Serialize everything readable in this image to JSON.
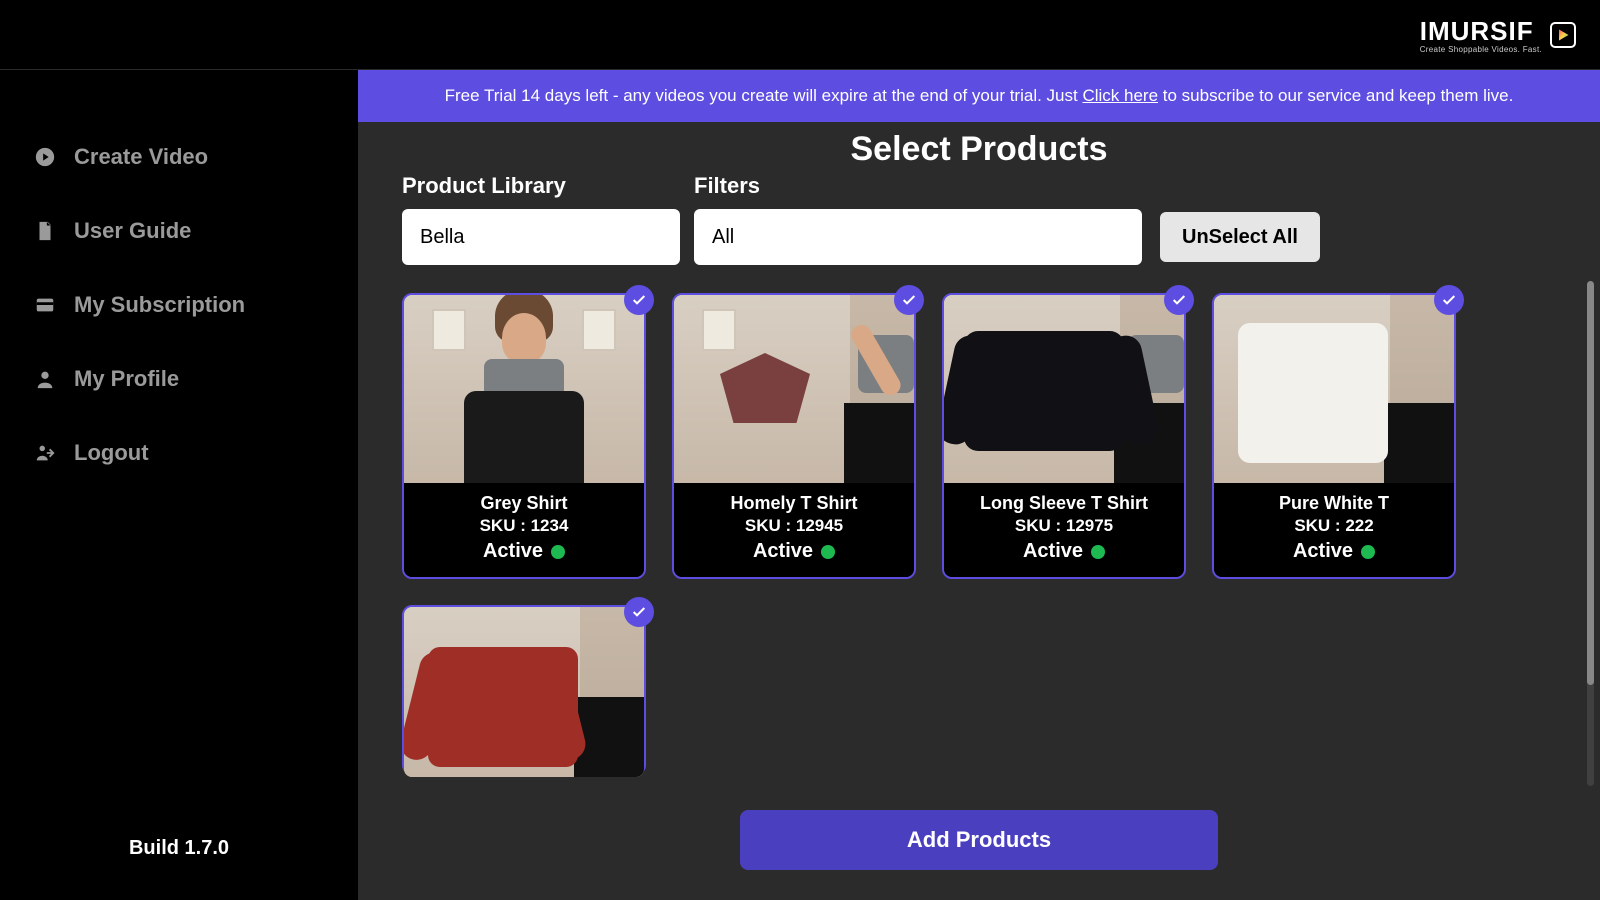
{
  "brand": {
    "name": "IMURSIF",
    "tagline": "Create Shoppable Videos. Fast."
  },
  "banner": {
    "pre": "Free Trial 14 days left - any videos you create will expire at the end of your trial. Just ",
    "link": "Click here",
    "post": " to subscribe to our service and keep them live."
  },
  "sidebar": {
    "items": [
      {
        "label": "Create Video",
        "icon": "play"
      },
      {
        "label": "User Guide",
        "icon": "doc"
      },
      {
        "label": "My Subscription",
        "icon": "card"
      },
      {
        "label": "My Profile",
        "icon": "user"
      },
      {
        "label": "Logout",
        "icon": "logout"
      }
    ],
    "build": "Build 1.7.0"
  },
  "page": {
    "title": "Select Products",
    "library_label": "Product Library",
    "library_value": "Bella",
    "filters_label": "Filters",
    "filters_value": "All",
    "unselect_label": "UnSelect All",
    "add_label": "Add Products"
  },
  "products": [
    {
      "name": "Grey Shirt",
      "sku": "SKU : 1234",
      "status": "Active",
      "selected": true
    },
    {
      "name": "Homely T Shirt",
      "sku": "SKU : 12945",
      "status": "Active",
      "selected": true
    },
    {
      "name": "Long Sleeve T Shirt",
      "sku": "SKU : 12975",
      "status": "Active",
      "selected": true
    },
    {
      "name": "Pure White T",
      "sku": "SKU : 222",
      "status": "Active",
      "selected": true
    },
    {
      "name": "",
      "sku": "",
      "status": "",
      "selected": true,
      "partial": true
    }
  ]
}
